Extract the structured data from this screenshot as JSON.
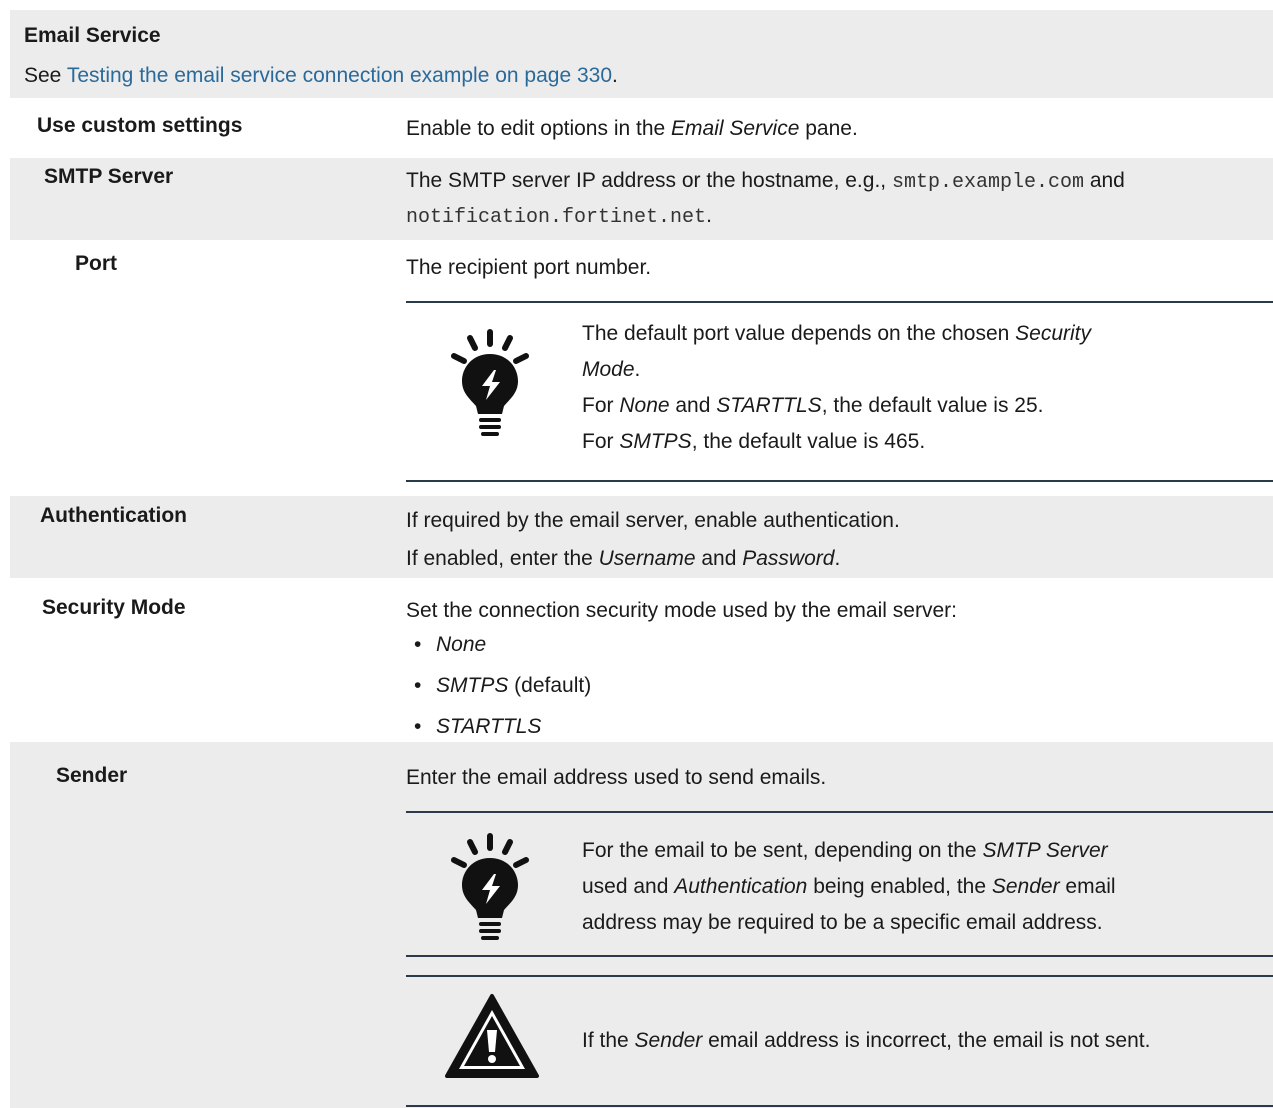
{
  "header": {
    "title": "Email Service",
    "see_prefix": "See ",
    "link_text": "Testing the email service connection example on page 330",
    "see_suffix": "."
  },
  "rows": {
    "custom": {
      "label": "Use custom settings",
      "desc_prefix": "Enable to edit options in the ",
      "desc_em": "Email Service",
      "desc_suffix": " pane."
    },
    "smtp": {
      "label": "SMTP Server",
      "desc_prefix": "The SMTP server IP address or the hostname, e.g., ",
      "code1": "smtp.example.com",
      "desc_mid": " and",
      "code2": "notification.fortinet.net",
      "desc_suffix": "."
    },
    "port": {
      "label": "Port",
      "desc": "The recipient port number.",
      "tip": {
        "line1_prefix": "The default port value depends on the chosen ",
        "line1_em": "Security",
        "line2_em": "Mode",
        "line2_suffix": ".",
        "line3_prefix": "For ",
        "line3_em1": "None",
        "line3_mid": " and ",
        "line3_em2": "STARTTLS",
        "line3_suffix": ", the default value is 25.",
        "line4_prefix": "For ",
        "line4_em": "SMTPS",
        "line4_suffix": ", the default value is 465."
      }
    },
    "auth": {
      "label": "Authentication",
      "line1": "If required by the email server, enable authentication.",
      "line2_prefix": "If enabled, enter the ",
      "line2_em1": "Username",
      "line2_mid": " and ",
      "line2_em2": "Password",
      "line2_suffix": "."
    },
    "security": {
      "label": "Security Mode",
      "desc": "Set the connection security mode used by the email server:",
      "options": [
        "None",
        "SMTPS",
        "STARTTLS"
      ],
      "default_suffix": " (default)"
    },
    "sender": {
      "label": "Sender",
      "desc": "Enter the email address used to send emails.",
      "tip": {
        "l1_prefix": "For the email to be sent, depending on the ",
        "l1_em": "SMTP Server",
        "l2_prefix": "used and ",
        "l2_em1": "Authentication",
        "l2_mid": " being enabled, the ",
        "l2_em2": "Sender",
        "l2_suffix": " email",
        "l3": "address may be required to be a specific email address."
      },
      "warning": {
        "prefix": "If the ",
        "em": "Sender",
        "suffix": " email address is incorrect, the email is not sent."
      }
    }
  },
  "icons": [
    "lightbulb-tip-icon",
    "warning-triangle-icon"
  ],
  "colors": {
    "link": "#2a6a9a",
    "band": "#ececec",
    "rule": "#2b3a4a"
  }
}
